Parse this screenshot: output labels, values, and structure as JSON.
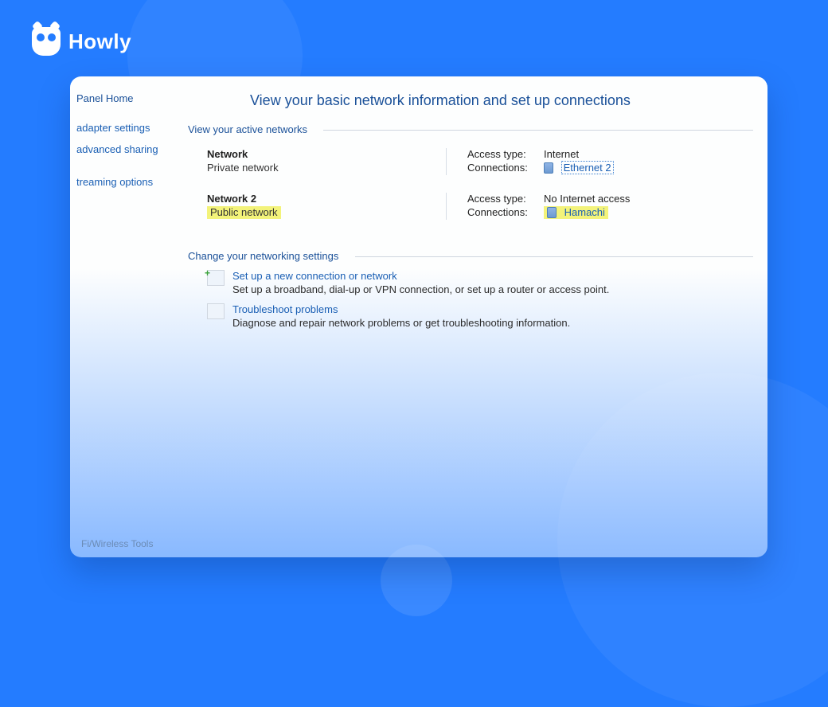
{
  "brand": {
    "name": "Howly"
  },
  "sidebar": {
    "home": "Panel Home",
    "items": [
      "adapter settings",
      "advanced sharing",
      "treaming options"
    ]
  },
  "main": {
    "title": "View your basic network information and set up connections",
    "active_header": "View your active networks",
    "networks": [
      {
        "name": "Network",
        "type": "Private network",
        "access_label": "Access type:",
        "access_value": "Internet",
        "conn_label": "Connections:",
        "conn_value": "Ethernet 2",
        "highlight_type": false,
        "highlight_conn": false,
        "boxed_conn": true
      },
      {
        "name": "Network 2",
        "type": "Public network",
        "access_label": "Access type:",
        "access_value": "No Internet access",
        "conn_label": "Connections:",
        "conn_value": "Hamachi",
        "highlight_type": true,
        "highlight_conn": true,
        "boxed_conn": false
      }
    ],
    "change_header": "Change your networking settings",
    "settings": [
      {
        "icon": "new-connection-icon",
        "title": "Set up a new connection or network",
        "desc": "Set up a broadband, dial-up or VPN connection, or set up a router or access point."
      },
      {
        "icon": "troubleshoot-icon",
        "title": "Troubleshoot problems",
        "desc": "Diagnose and repair network problems or get troubleshooting information."
      }
    ]
  },
  "footnote": "Fi/Wireless Tools"
}
